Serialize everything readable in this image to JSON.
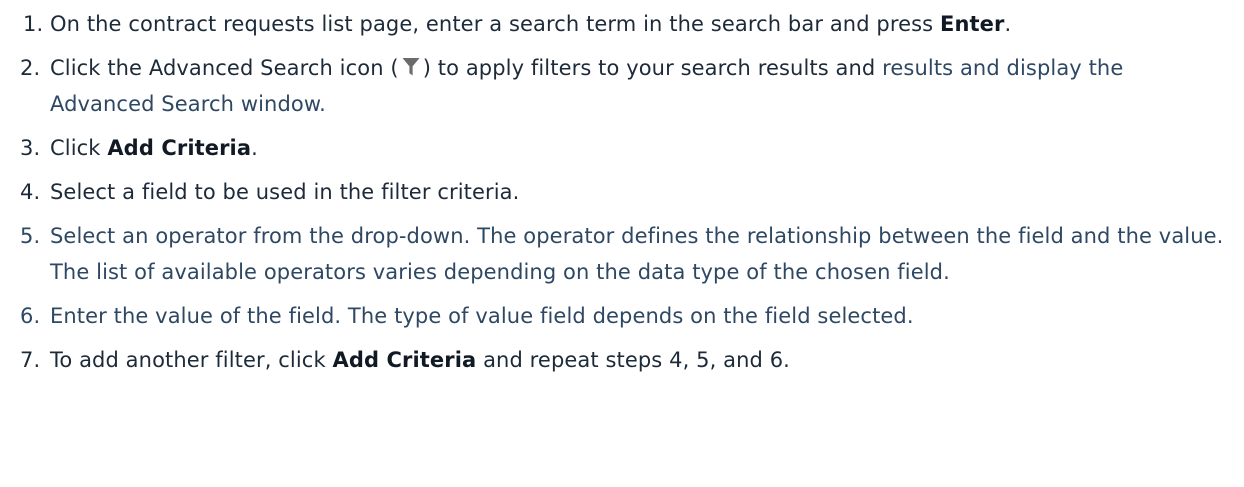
{
  "steps": [
    {
      "number": "1.",
      "text_a": "On the contract requests list page, enter a search term in the search bar and press ",
      "bold": "Enter",
      "text_b": "."
    },
    {
      "number": "2.",
      "text_a": "Click the Advanced Search icon (",
      "icon": "filter-funnel-icon",
      "text_b": ") to apply filters to your search results and ",
      "text_c": "results and display the Advanced Search window."
    },
    {
      "number": "3.",
      "text_a": "Click ",
      "bold": "Add Criteria",
      "text_b": "."
    },
    {
      "number": "4.",
      "text_a": "Select a field to be used in the filter criteria."
    },
    {
      "number": "5.",
      "text_a": "Select an operator from the drop-down. The operator defines the relationship between the field and the value. The list of available operators varies depending on the data type of the chosen field."
    },
    {
      "number": "6.",
      "text_a": "Enter the value of the field. The type of value field depends on the field selected."
    },
    {
      "number": "7.",
      "text_a": "To add another filter, click ",
      "bold": "Add Criteria",
      "text_b": " and repeat steps 4, 5, and 6."
    }
  ],
  "colors": {
    "text": "#1d2a3a",
    "muted_text": "#2e4863",
    "icon": "#6b6b6b"
  }
}
